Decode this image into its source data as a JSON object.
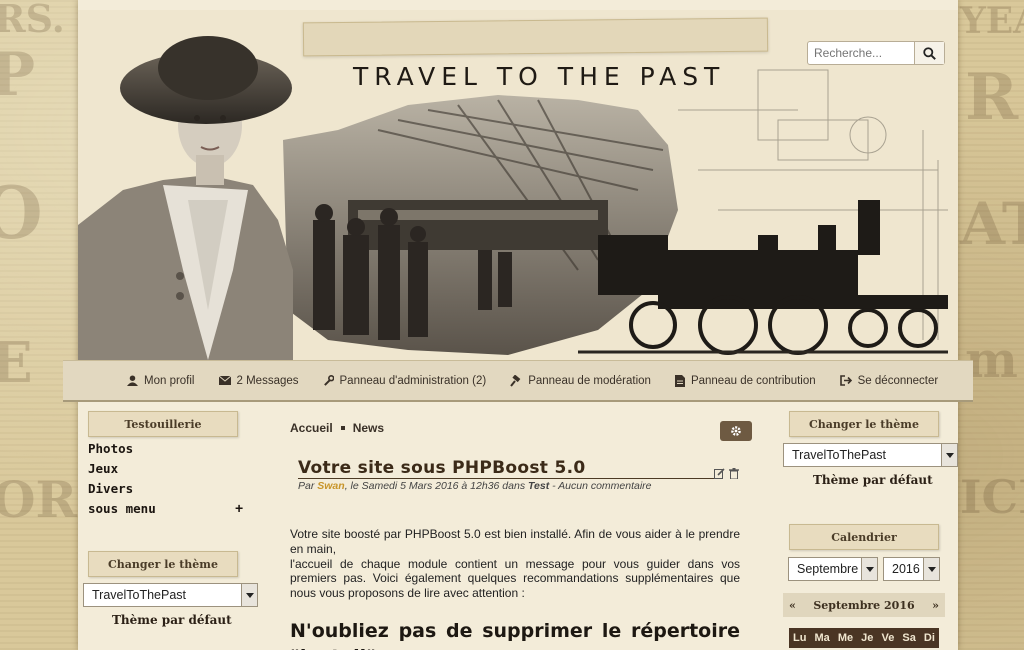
{
  "header": {
    "site_title": "TRAVEL TO THE PAST",
    "search_placeholder": "Recherche..."
  },
  "navbar": {
    "items": [
      {
        "label": "Mon profil",
        "icon": "user-icon"
      },
      {
        "label": "2 Messages",
        "icon": "envelope-icon"
      },
      {
        "label": "Panneau d'administration (2)",
        "icon": "wrench-icon"
      },
      {
        "label": "Panneau de modération",
        "icon": "gavel-icon"
      },
      {
        "label": "Panneau de contribution",
        "icon": "file-icon"
      },
      {
        "label": "Se déconnecter",
        "icon": "sign-out-icon"
      }
    ]
  },
  "left_sidebar": {
    "menu_title": "Testouillerie",
    "menu_items": [
      "Photos",
      "Jeux",
      "Divers",
      "sous menu"
    ],
    "expand_symbol": "+",
    "theme_title": "Changer le thème",
    "theme_select": "TravelToThePast",
    "default_theme": "Thème par défaut"
  },
  "right_sidebar": {
    "theme_title": "Changer le thème",
    "theme_select": "TravelToThePast",
    "default_theme": "Thème par défaut",
    "calendar_title": "Calendrier",
    "month_select": "Septembre",
    "year_select": "2016",
    "calendar_month_label": "Septembre 2016",
    "prev": "«",
    "next": "»",
    "weekdays": [
      "Lu",
      "Ma",
      "Me",
      "Je",
      "Ve",
      "Sa",
      "Di"
    ]
  },
  "breadcrumb": {
    "home": "Accueil",
    "current": "News"
  },
  "article": {
    "title": "Votre site sous PHPBoost 5.0",
    "meta_prefix": "Par ",
    "author": "Swan",
    "meta_date": ", le Samedi 5 Mars 2016 à 12h36 dans ",
    "category": "Test",
    "meta_comments": " - Aucun commentaire",
    "paragraph_1": "Votre site boosté par PHPBoost 5.0 est bien installé. Afin de vous aider à le prendre en main,",
    "paragraph_2": "l'accueil de chaque module contient un message pour vous guider dans vos premiers pas. Voici également quelques recommandations supplémentaires que nous vous proposons de lire avec attention :",
    "heading": "N'oubliez pas de supprimer le répertoire \"install\""
  },
  "colors": {
    "page_bg": "#f3ecd9",
    "accent_author": "#c8952a",
    "calendar_days_bg": "#4a3524",
    "gear_button_bg": "#6e5a42"
  }
}
